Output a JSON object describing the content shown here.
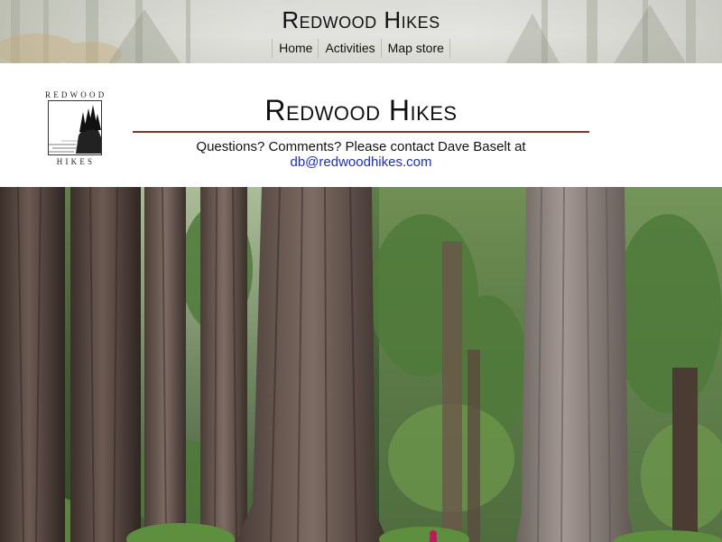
{
  "banner": {
    "title": "Redwood Hikes",
    "nav": [
      {
        "label": "Home"
      },
      {
        "label": "Activities"
      },
      {
        "label": "Map store"
      }
    ]
  },
  "logo": {
    "top_text": "REDWOOD",
    "bottom_text": "HIKES"
  },
  "header": {
    "title": "Redwood Hikes",
    "contact_text": "Questions? Comments? Please contact Dave Baselt at",
    "contact_email": "db@redwoodhikes.com"
  },
  "colors": {
    "rule": "#7a3a28",
    "link": "#1a2bd6",
    "text": "#111111"
  },
  "hero": {
    "icon": "redwood-forest-photo"
  }
}
